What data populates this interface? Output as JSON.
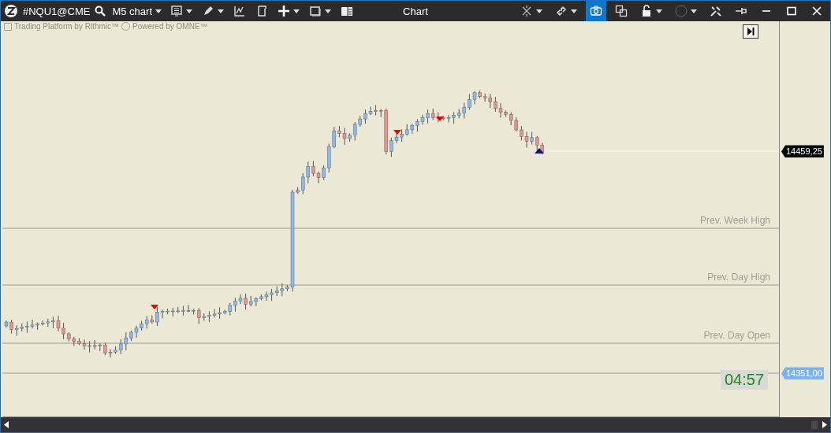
{
  "window": {
    "title": "Chart"
  },
  "toolbar": {
    "symbol": "#NQU1@CME",
    "timeframe": "M5 chart",
    "left_tools": [
      {
        "kind": "template",
        "menu": true
      },
      {
        "kind": "pencil",
        "menu": true
      },
      {
        "kind": "indicator",
        "menu": false
      },
      {
        "kind": "page",
        "menu": false
      },
      {
        "kind": "plus",
        "menu": true
      },
      {
        "kind": "window",
        "menu": true
      },
      {
        "kind": "panel",
        "menu": false
      }
    ],
    "right_tools": [
      {
        "kind": "crosshair",
        "menu": true,
        "selected": false
      },
      {
        "kind": "link",
        "menu": true,
        "selected": false
      },
      {
        "kind": "camera",
        "menu": false,
        "selected": true
      },
      {
        "kind": "copy",
        "menu": false,
        "selected": false
      },
      {
        "kind": "lock",
        "menu": true,
        "selected": false
      },
      {
        "kind": "circle",
        "menu": true,
        "selected": false
      },
      {
        "kind": "tools",
        "menu": false,
        "selected": false
      },
      {
        "kind": "pin",
        "menu": false,
        "selected": false
      }
    ]
  },
  "chart": {
    "branding": [
      "Trading Platform by Rithmic™",
      "Powered by OMNE™"
    ],
    "levels": [
      {
        "label": "Prev. Week High"
      },
      {
        "label": "Prev. Day High"
      },
      {
        "label": "Prev. Day Open"
      }
    ],
    "price_tags": [
      {
        "text": "14459,25",
        "kind": "last"
      },
      {
        "text": "14351,00",
        "kind": "bid"
      }
    ],
    "timer": "04:57"
  }
}
